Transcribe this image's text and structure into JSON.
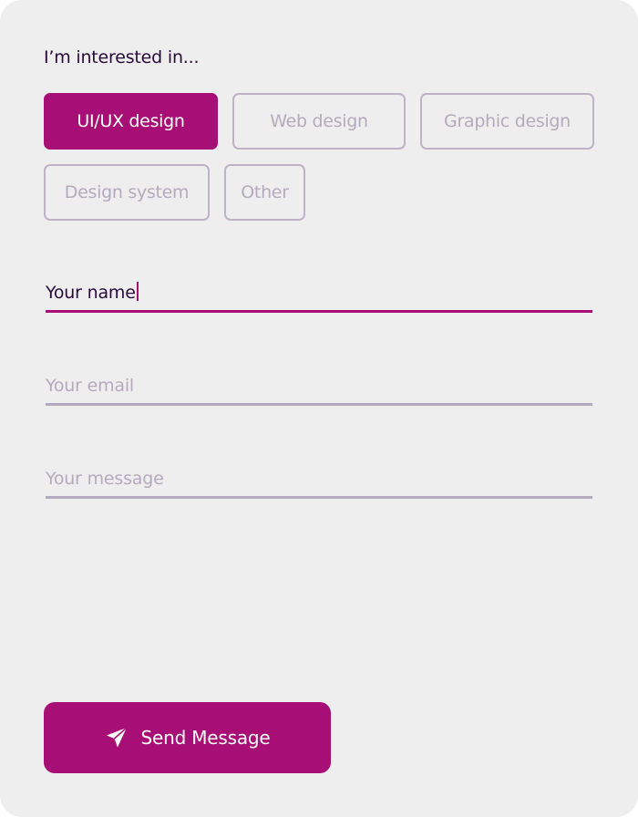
{
  "form": {
    "heading": "I’m interested in...",
    "interests": [
      {
        "label": "UI/UX design",
        "selected": true
      },
      {
        "label": "Web design",
        "selected": false
      },
      {
        "label": "Graphic design",
        "selected": false
      },
      {
        "label": "Design system",
        "selected": false
      },
      {
        "label": "Other",
        "selected": false
      }
    ],
    "fields": {
      "name": {
        "value": "Your name",
        "focused": true
      },
      "email": {
        "placeholder": "Your email"
      },
      "message": {
        "placeholder": "Your message"
      }
    },
    "submit": {
      "label": "Send Message",
      "icon": "paper-plane-icon"
    }
  },
  "colors": {
    "accent": "#a80f76",
    "background": "#eeeeee",
    "text": "#2a0a3a",
    "muted": "#b5aabd",
    "chip_border": "#bdb2c6"
  }
}
